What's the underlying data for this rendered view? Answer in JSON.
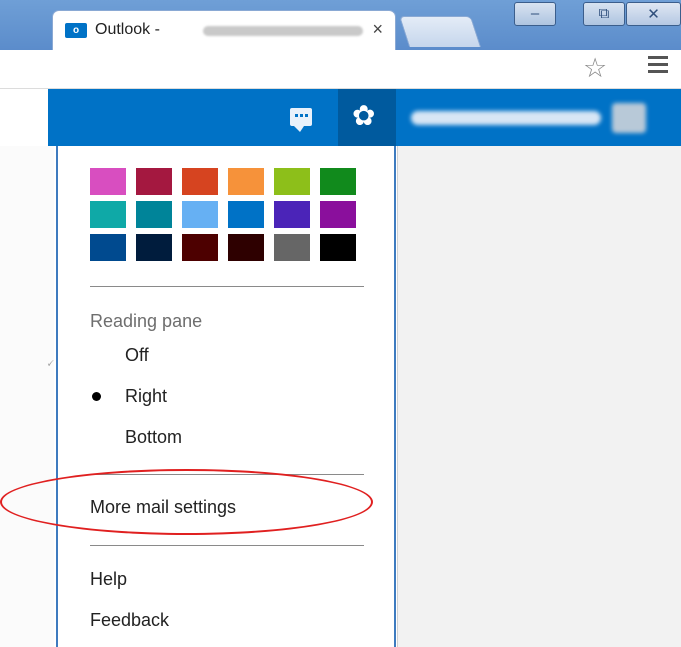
{
  "browser": {
    "tab_title": "Outlook -",
    "tab_favicon_text": "o",
    "tab_close": "×",
    "window_min": "–",
    "window_max": "⧉",
    "window_close": "✕"
  },
  "toolbar": {
    "bookmark_star": "☆"
  },
  "header": {
    "settings_glyph": "✿"
  },
  "settings": {
    "theme_colors": [
      [
        "#d84ec0",
        "#a41840",
        "#d64420",
        "#f6923a",
        "#8dbf1a",
        "#118a1c"
      ],
      [
        "#0fa9a7",
        "#008499",
        "#66b0f3",
        "#0072c6",
        "#4b24b8",
        "#8a0f9c"
      ],
      [
        "#004a8f",
        "#001c3d",
        "#4d0000",
        "#2e0000",
        "#666666",
        "#000000"
      ]
    ],
    "reading_pane": {
      "label": "Reading pane",
      "options": [
        "Off",
        "Right",
        "Bottom"
      ],
      "selected": "Right"
    },
    "more_mail_settings": "More mail settings",
    "help": "Help",
    "feedback": "Feedback"
  },
  "colors": {
    "outlook_blue": "#0072c6",
    "gear_active_bg": "#005a9e",
    "panel_border": "#3e7bbf",
    "annotation_red": "#e02020"
  }
}
